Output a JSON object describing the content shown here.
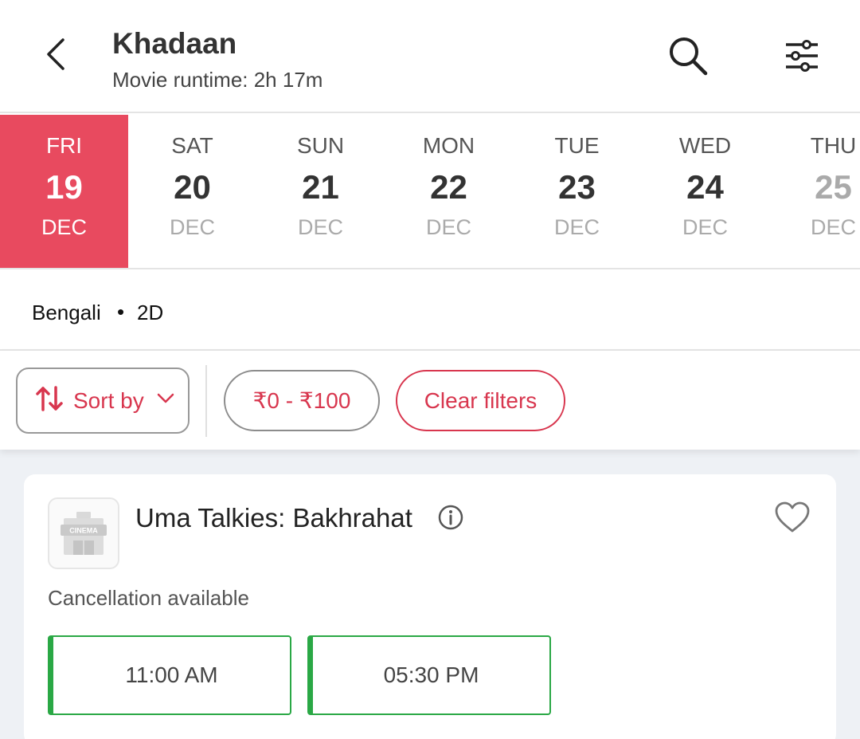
{
  "header": {
    "title": "Khadaan",
    "subtitle": "Movie runtime: 2h 17m"
  },
  "dates": [
    {
      "dow": "FRI",
      "day": "19",
      "month": "DEC"
    },
    {
      "dow": "SAT",
      "day": "20",
      "month": "DEC"
    },
    {
      "dow": "SUN",
      "day": "21",
      "month": "DEC"
    },
    {
      "dow": "MON",
      "day": "22",
      "month": "DEC"
    },
    {
      "dow": "TUE",
      "day": "23",
      "month": "DEC"
    },
    {
      "dow": "WED",
      "day": "24",
      "month": "DEC"
    },
    {
      "dow": "THU",
      "day": "25",
      "month": "DEC"
    }
  ],
  "format": {
    "language": "Bengali",
    "separator": "•",
    "dimension": "2D"
  },
  "filters": {
    "sort_label": "Sort by",
    "price_label": "₹0 - ₹100",
    "clear_label": "Clear filters"
  },
  "cinema": {
    "logo_text": "CINEMA",
    "name": "Uma Talkies: Bakhrahat",
    "cancellation": "Cancellation available",
    "showtimes": [
      "11:00 AM",
      "05:30 PM"
    ]
  },
  "colors": {
    "accent": "#e84a5f",
    "accent_text": "#d8364e",
    "available": "#2aa845"
  },
  "icons": {
    "back": "chevron-left-icon",
    "search": "search-icon",
    "filter": "sliders-icon",
    "sort": "sort-arrows-icon",
    "info": "info-icon",
    "favorite": "heart-icon"
  }
}
